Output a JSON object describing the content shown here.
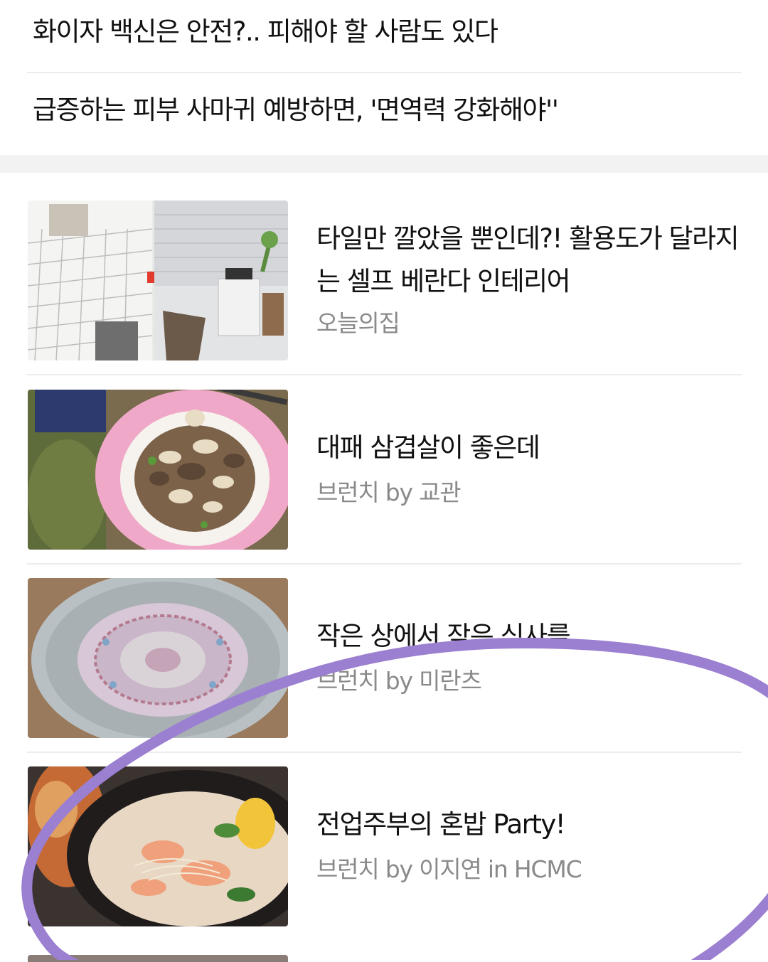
{
  "top_headlines": [
    {
      "title": "화이자 백신은 안전?.. 피해야 할 사람도 있다"
    },
    {
      "title": "급증하는 피부 사마귀 예방하면, '면역력 강화해야''"
    }
  ],
  "articles": [
    {
      "title": "타일만 깔았을 뿐인데?! 활용도가 달라지는 셀프 베란다 인테리어",
      "source": "오늘의집"
    },
    {
      "title": "대패 삼겹살이 좋은데",
      "source": "브런치 by 교관"
    },
    {
      "title": "작은 상에서 작은 식사를",
      "source": "브런치 by 미란츠"
    },
    {
      "title": "전업주부의 혼밥 Party!",
      "source": "브런치 by 이지연 in HCMC"
    }
  ],
  "colors": {
    "annotation_circle": "#9b7fd1",
    "divider": "#ececec",
    "source_text": "#8a8a8a",
    "section_gap": "#f2f2f2"
  }
}
